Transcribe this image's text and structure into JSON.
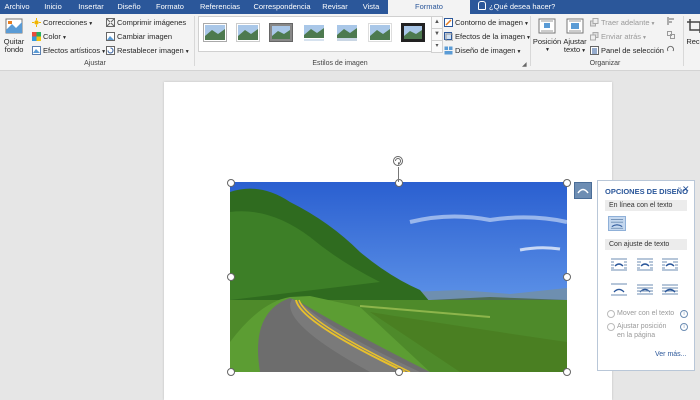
{
  "tabs": [
    "Archivo",
    "Inicio",
    "Insertar",
    "Diseño",
    "Formato",
    "Referencias",
    "Correspondencia",
    "Revisar",
    "Vista",
    "Formato"
  ],
  "active_tab_index": 9,
  "tell_me": "¿Qué desea hacer?",
  "ribbon": {
    "remove_bg": [
      "Quitar",
      "fondo"
    ],
    "adjust": {
      "corrections": "Correcciones",
      "color": "Color",
      "artistic": "Efectos artísticos",
      "compress": "Comprimir imágenes",
      "change": "Cambiar imagen",
      "reset": "Restablecer imagen",
      "group_label": "Ajustar"
    },
    "styles": {
      "group_label": "Estilos de imagen",
      "outline": "Contorno de imagen",
      "effects": "Efectos de la imagen",
      "layout": "Diseño de imagen"
    },
    "arrange": {
      "position": "Posición",
      "wrap": [
        "Ajustar",
        "texto"
      ],
      "forward": "Traer adelante",
      "backward": "Enviar atrás",
      "selection_pane": "Panel de selección",
      "group_label": "Organizar"
    },
    "crop_partial": "Rec"
  },
  "panel": {
    "title": "OPCIONES DE DISEÑO",
    "inline_section": "En línea con el texto",
    "wrap_section": "Con ajuste de texto",
    "move_with_text": "Mover con el texto",
    "fix_position": [
      "Ajustar posición",
      "en la página"
    ],
    "see_more": "Ver más..."
  },
  "colors": {
    "ribbon_blue": "#2b579a",
    "ribbon_bg": "#f3f3f3",
    "canvas_bg": "#e6e6e6",
    "layout_button": "#6d8db3"
  }
}
